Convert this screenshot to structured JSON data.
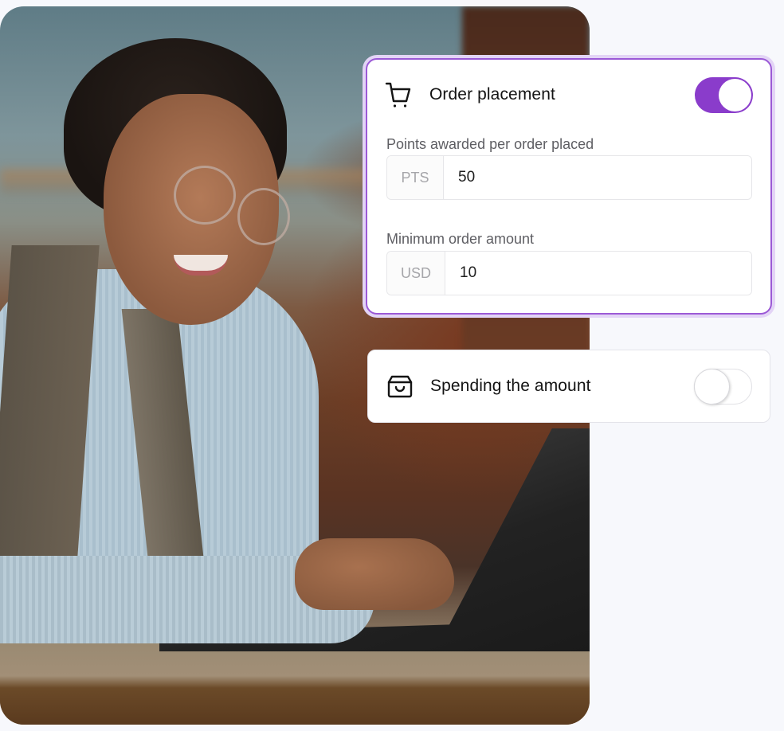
{
  "photo": {
    "description": "Smiling woman with glasses typing on a laptop in a cafe"
  },
  "order_placement": {
    "icon": "shopping-cart-icon",
    "title": "Order placement",
    "toggle_on": true,
    "points_field": {
      "label": "Points awarded per order placed",
      "prefix": "PTS",
      "value": "50"
    },
    "min_amount_field": {
      "label": "Minimum order amount",
      "prefix": "USD",
      "value": "10"
    }
  },
  "spending_amount": {
    "icon": "shopping-bag-icon",
    "title": "Spending the amount",
    "toggle_on": false
  },
  "colors": {
    "accent": "#8A3CCB",
    "accent_border": "#9B59D6",
    "accent_halo": "#E3D4F6",
    "background": "#F7F8FC"
  }
}
